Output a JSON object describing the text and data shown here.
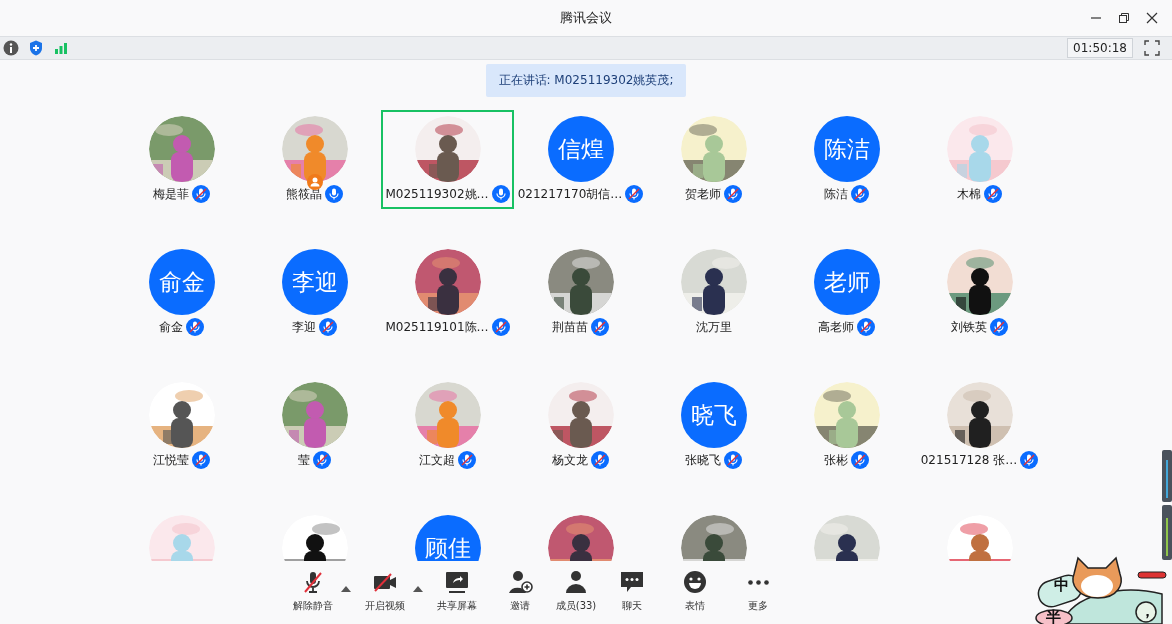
{
  "window": {
    "title": "腾讯会议"
  },
  "status_bar": {
    "timer": "01:50:18"
  },
  "speaking_banner": "正在讲话: M025119302姚英茂;",
  "participants": [
    {
      "name": "梅是菲",
      "muted": true,
      "selected": false
    },
    {
      "name": "熊筱晶",
      "muted": false,
      "selected": false,
      "host": true
    },
    {
      "name": "M025119302姚…",
      "muted": false,
      "selected": true
    },
    {
      "name": "021217170胡信…",
      "avatar": {
        "kind": "initials",
        "text": "信煌"
      },
      "muted": true,
      "selected": false
    },
    {
      "name": "贺老师",
      "muted": true,
      "selected": false
    },
    {
      "name": "陈洁",
      "avatar": {
        "kind": "initials",
        "text": "陈洁"
      },
      "muted": true,
      "selected": false
    },
    {
      "name": "木棉",
      "muted": true,
      "selected": false
    },
    {
      "name": "俞金",
      "avatar": {
        "kind": "initials",
        "text": "俞金"
      },
      "muted": true,
      "selected": false
    },
    {
      "name": "李迎",
      "avatar": {
        "kind": "initials",
        "text": "李迎"
      },
      "muted": true,
      "selected": false
    },
    {
      "name": "M025119101陈…",
      "muted": true,
      "selected": false
    },
    {
      "name": "荆苗苗",
      "muted": true,
      "selected": false
    },
    {
      "name": "沈万里",
      "selected": false
    },
    {
      "name": "高老师",
      "avatar": {
        "kind": "initials",
        "text": "老师"
      },
      "muted": true,
      "selected": false
    },
    {
      "name": "刘铁英",
      "muted": true,
      "selected": false
    },
    {
      "name": "江悦莹",
      "muted": true,
      "selected": false
    },
    {
      "name": "莹",
      "muted": true,
      "selected": false
    },
    {
      "name": "江文超",
      "muted": true,
      "selected": false
    },
    {
      "name": "杨文龙",
      "muted": true,
      "selected": false
    },
    {
      "name": "张晓飞",
      "avatar": {
        "kind": "initials",
        "text": "晓飞"
      },
      "muted": true,
      "selected": false
    },
    {
      "name": "张彬",
      "muted": true,
      "selected": false
    },
    {
      "name": "021517128 张…",
      "muted": true,
      "selected": false
    },
    {
      "selected": false
    },
    {
      "selected": false
    },
    {
      "avatar": {
        "kind": "initials",
        "text": "顾佳"
      },
      "selected": false
    },
    {
      "selected": false
    },
    {
      "selected": false
    },
    {
      "selected": false
    },
    {
      "selected": false
    }
  ],
  "toolbar": [
    {
      "label": "解除静音",
      "menu": true
    },
    {
      "label": "开启视频",
      "menu": true
    },
    {
      "label": "共享屏幕",
      "menu": false
    },
    {
      "label": "邀请",
      "menu": false
    },
    {
      "label": "成员(33)",
      "menu": false
    },
    {
      "label": "聊天",
      "menu": false
    },
    {
      "label": "表情",
      "menu": false
    },
    {
      "label": "更多",
      "menu": false
    }
  ],
  "ime": {
    "mode": "中",
    "width": "半",
    "punct": "，"
  }
}
